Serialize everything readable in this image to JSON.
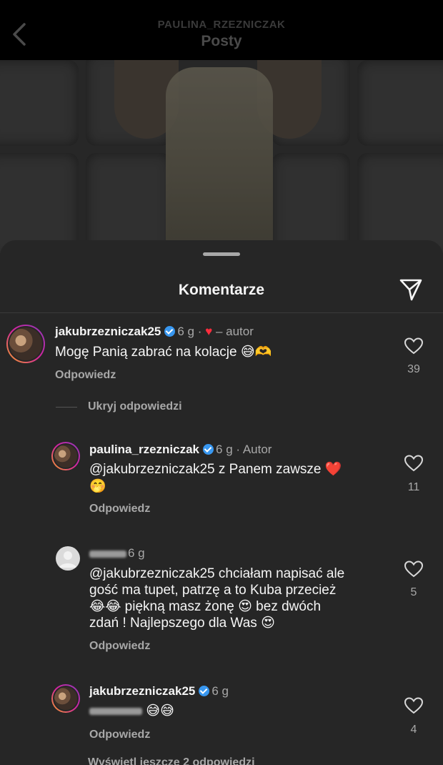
{
  "header": {
    "username": "PAULINA_RZEZNICZAK",
    "title": "Posty"
  },
  "sheet": {
    "title": "Komentarze",
    "toggle_replies_label": "Ukryj odpowiedzi",
    "more_replies_label": "Wyświetl jeszcze 2 odpowiedzi"
  },
  "comments": [
    {
      "username": "jakubrzezniczak25",
      "time": "6 g",
      "suffix": "– autor",
      "text": "Mogę Panią zabrać na kolacje 😅🫶",
      "reply_label": "Odpowiedz",
      "likes": "39"
    },
    {
      "username": "paulina_rzezniczak",
      "time": "6 g",
      "suffix": "· Autor",
      "text_line1": "@jakubrzezniczak25 z Panem zawsze ❤️",
      "text_line2": "🤭",
      "reply_label": "Odpowiedz",
      "likes": "11"
    },
    {
      "time": "6 g",
      "text_line1": "@jakubrzezniczak25 chciałam napisać ale",
      "text_line2": "gość ma tupet, patrzę a to Kuba przecież",
      "text_line3": "😂😂 piękną masz żonę 😍 bez dwóch",
      "text_line4": "zdań ! Najlepszego dla Was 😍",
      "reply_label": "Odpowiedz",
      "likes": "5"
    },
    {
      "username": "jakubrzezniczak25",
      "time": "6 g",
      "text_emojis": "😅😅",
      "reply_label": "Odpowiedz",
      "likes": "4"
    }
  ],
  "icons": [
    "back-chevron-icon",
    "send-icon",
    "verified-icon",
    "heart-icon",
    "like-heart-icon"
  ],
  "colors": {
    "background": "#262626",
    "topbar": "#000000",
    "verified": "#3897f0",
    "heart": "#ff2d3d",
    "secondary_text": "#a8a8a8"
  }
}
